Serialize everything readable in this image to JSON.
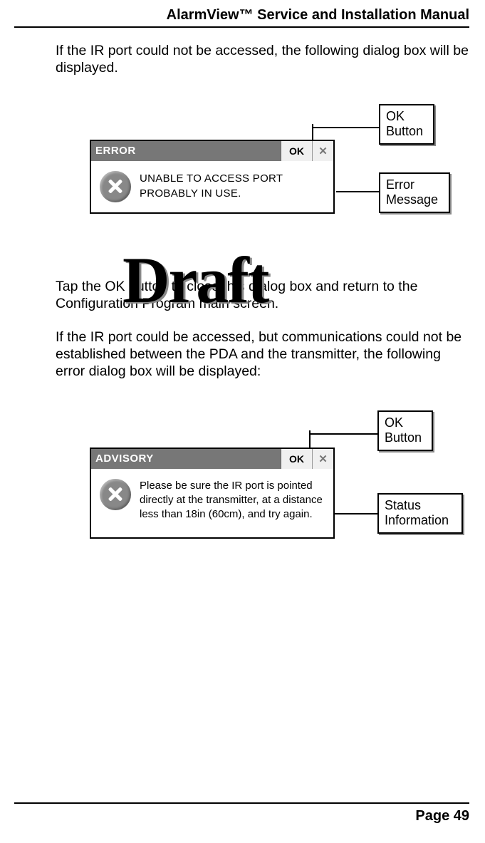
{
  "header": {
    "title": "AlarmView™ Service and Installation Manual"
  },
  "paragraphs": {
    "p1": "If the IR port could not be accessed, the following dialog box will be displayed.",
    "p2": "Tap the OK button to close this dialog box and return to the Configuration Program main screen.",
    "p3": "If the IR port could be accessed, but communications could not be established between the PDA and the transmitter, the following error dialog box will be displayed:"
  },
  "dialog1": {
    "title": "ERROR",
    "ok_label": "OK",
    "message": "UNABLE TO ACCESS PORT PROBABLY IN USE."
  },
  "dialog2": {
    "title": "ADVISORY",
    "ok_label": "OK",
    "message": "Please be sure the IR port is pointed directly at the transmitter, at a distance less than 18in (60cm), and try again."
  },
  "callouts": {
    "ok_button": "OK\nButton",
    "error_message": "Error\nMessage",
    "status_info": "Status\nInformation"
  },
  "watermark": "Draft",
  "footer": {
    "page": "Page 49"
  }
}
